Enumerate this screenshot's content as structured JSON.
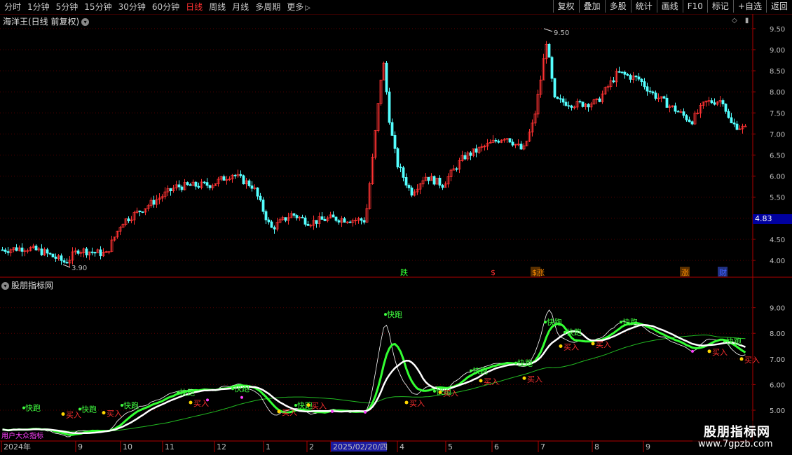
{
  "toolbar": {
    "periods": [
      "分时",
      "1分钟",
      "5分钟",
      "15分钟",
      "30分钟",
      "60分钟",
      "日线",
      "周线",
      "月线",
      "多周期",
      "更多"
    ],
    "active_period": "日线",
    "more_arrow": "▷",
    "right_buttons": [
      "复权",
      "叠加",
      "多股",
      "统计",
      "画线",
      "F10",
      "标记",
      "+自选",
      "返回"
    ]
  },
  "main_chart": {
    "title": "海洋王(日线 前复权)",
    "price_labels": [
      "9.50",
      "9.00",
      "8.50",
      "8.00",
      "7.50",
      "7.00",
      "6.50",
      "6.00",
      "5.50",
      "5.00",
      "4.50",
      "4.00"
    ],
    "current_price": "4.83",
    "high_marker": "9.50",
    "low_marker": "3.90",
    "event_tags": [
      "跌",
      "$",
      "$涨",
      "涨",
      "财"
    ],
    "icons": [
      "diamond-icon",
      "scroll-icon"
    ]
  },
  "indicator": {
    "title": "股朋指标网",
    "price_labels": [
      "9.00",
      "8.00",
      "7.00",
      "6.00",
      "5.00"
    ],
    "run_label": "快跑",
    "buy_label": "买入",
    "bottom_left_text": "用户大众指标",
    "colors": {
      "white_line": "#ffffff",
      "bright_green": "#33ff33",
      "thin_green": "#22bb22",
      "buy_text": "#ff3030",
      "run_text": "#40ff40"
    }
  },
  "date_axis": {
    "labels": [
      "2024年",
      "9",
      "10",
      "11",
      "12",
      "1",
      "2",
      "2025/02/20/四",
      "4",
      "5",
      "6",
      "7",
      "8",
      "9"
    ]
  },
  "watermark": {
    "title": "股朋指标网",
    "url": "www.7gpzb.com"
  },
  "colors": {
    "up": "#ff3232",
    "down": "#54ffff",
    "grid": "#5a0000",
    "axis": "#b00000"
  }
}
